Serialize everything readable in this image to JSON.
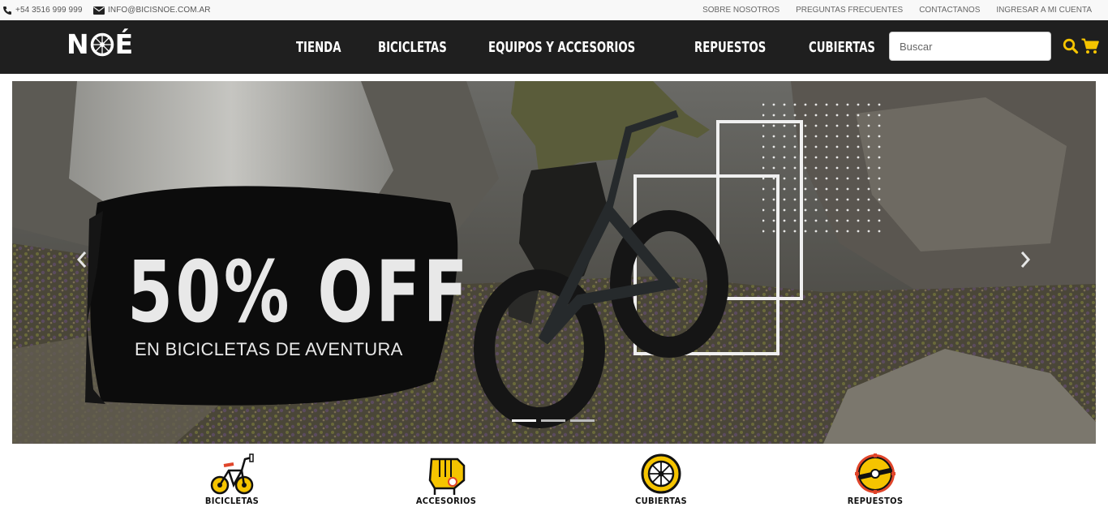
{
  "topbar": {
    "phone": "+54 3516 999 999",
    "email": "INFO@BICISNOE.COM.AR",
    "links": [
      "SOBRE NOSOTROS",
      "PREGUNTAS FRECUENTES",
      "CONTACTANOS",
      "INGRESAR A MI CUENTA"
    ]
  },
  "header": {
    "logo": {
      "left": "N",
      "right": "É"
    },
    "menu": [
      "TIENDA",
      "BICICLETAS",
      "EQUIPOS Y ACCESORIOS",
      "REPUESTOS",
      "CUBIERTAS"
    ],
    "search_placeholder": "Buscar",
    "accent_color": "#f5c400"
  },
  "hero": {
    "headline": "50% OFF",
    "subline": "EN BICICLETAS DE AVENTURA",
    "slide_count": 3,
    "active_slide": 1
  },
  "categories": [
    {
      "label": "BICICLETAS",
      "icon": "bicycle-icon"
    },
    {
      "label": "ACCESORIOS",
      "icon": "glove-icon"
    },
    {
      "label": "CUBIERTAS",
      "icon": "tire-icon"
    },
    {
      "label": "REPUESTOS",
      "icon": "chainring-icon"
    }
  ]
}
